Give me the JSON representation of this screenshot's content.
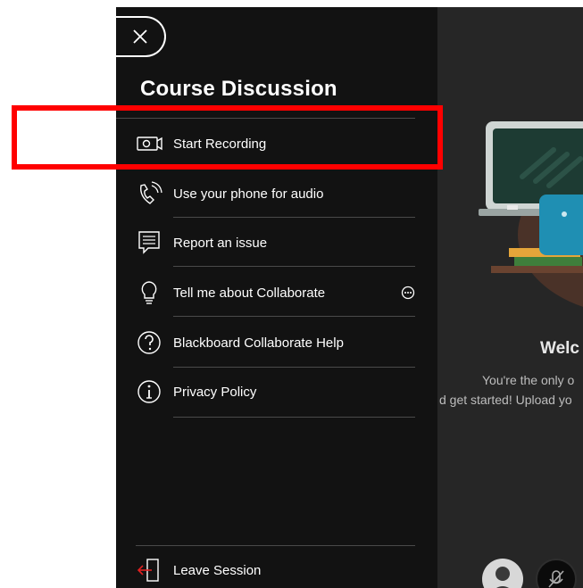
{
  "panel": {
    "title": "Course Discussion",
    "menu": [
      {
        "label": "Start Recording",
        "icon": "record-camera-icon"
      },
      {
        "label": "Use your phone for audio",
        "icon": "phone-audio-icon"
      },
      {
        "label": "Report an issue",
        "icon": "report-issue-icon"
      },
      {
        "label": "Tell me about Collaborate",
        "icon": "lightbulb-icon",
        "has_more": true
      },
      {
        "label": "Blackboard Collaborate Help",
        "icon": "help-question-icon"
      },
      {
        "label": "Privacy Policy",
        "icon": "info-icon"
      }
    ],
    "leave_label": "Leave Session"
  },
  "stage": {
    "welcome_title": "Welc",
    "welcome_line1": "You're the only o",
    "welcome_line2": "d get started! Upload yo"
  },
  "colors": {
    "panel_bg": "#121212",
    "stage_bg": "#262626",
    "highlight": "#ff0000",
    "leave_icon": "#e02020"
  }
}
